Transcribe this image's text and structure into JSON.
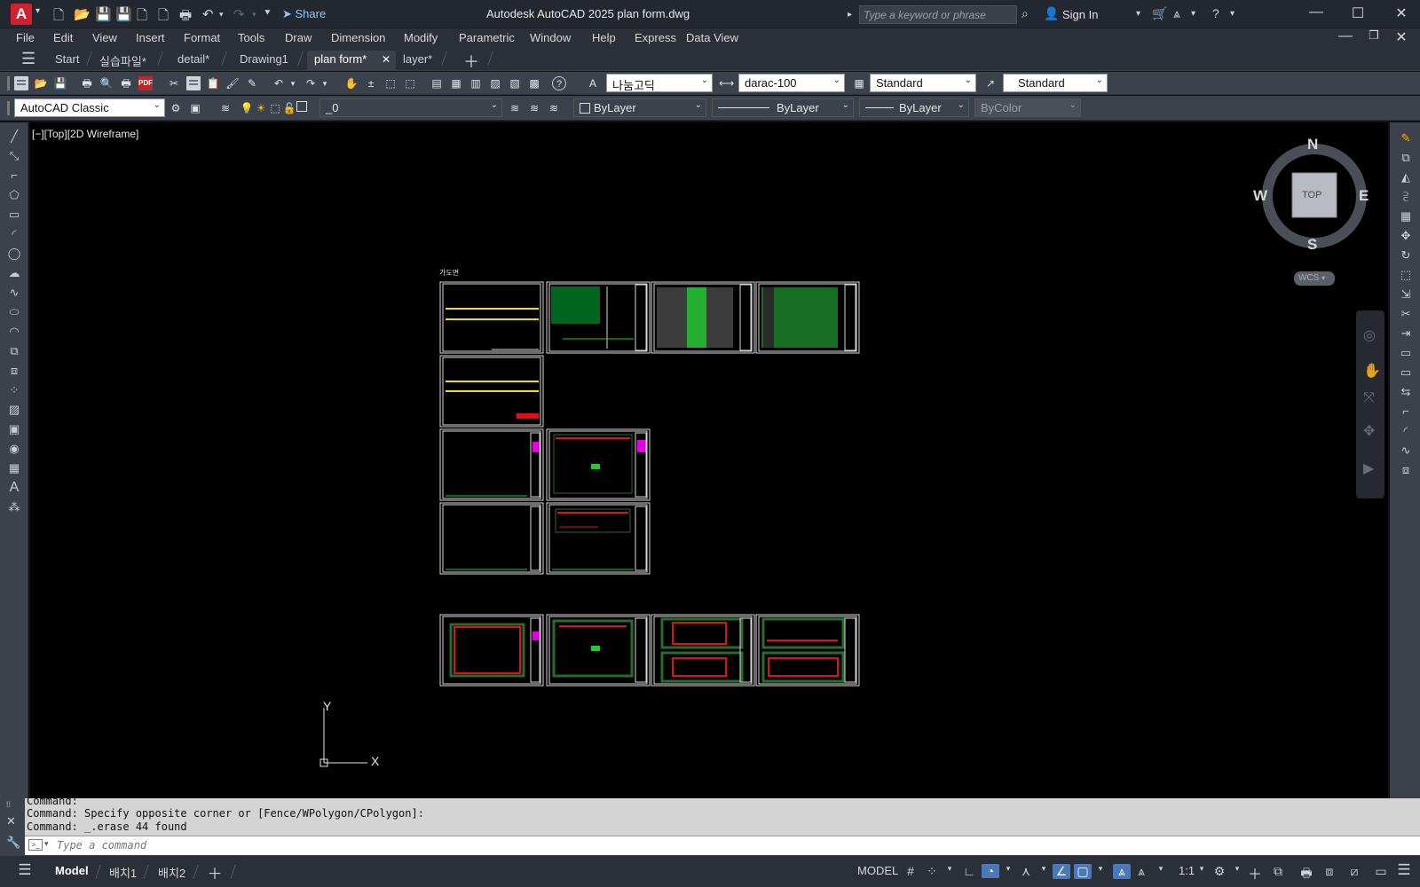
{
  "titlebar": {
    "app_letter": "A",
    "share_label": "Share",
    "title": "Autodesk AutoCAD 2025    plan form.dwg",
    "search_placeholder": "Type a keyword or phrase",
    "signin_label": "Sign In"
  },
  "menubar": {
    "items": [
      "File",
      "Edit",
      "View",
      "Insert",
      "Format",
      "Tools",
      "Draw",
      "Dimension",
      "Modify",
      "Parametric",
      "Window",
      "Help",
      "Express",
      "Data View"
    ]
  },
  "tabs": [
    {
      "label": "Start"
    },
    {
      "label": "실습파일*"
    },
    {
      "label": "detail*"
    },
    {
      "label": "Drawing1"
    },
    {
      "label": "plan form*",
      "active": true,
      "close": "✕"
    },
    {
      "label": "layer*"
    }
  ],
  "toolbar1": {
    "font": "나눔고딕",
    "dimstyle": "darac-100",
    "tablestyle": "Standard",
    "mleaderstyle": "Standard"
  },
  "toolbar2": {
    "workspace": "AutoCAD Classic",
    "layer": "_0",
    "color": "ByLayer",
    "linetype": "ByLayer",
    "lineweight": "ByLayer",
    "plotstyle": "ByColor"
  },
  "viewport": {
    "label": "[−][Top][2D Wireframe]",
    "sheet_group_label": "가도면"
  },
  "viewcube": {
    "north": "N",
    "south": "S",
    "east": "E",
    "west": "W",
    "face": "TOP",
    "wcs": "WCS"
  },
  "ucs": {
    "x": "X",
    "y": "Y"
  },
  "command": {
    "lines": [
      "Command:",
      "Command: Specify opposite corner or [Fence/WPolygon/CPolygon]:",
      "Command: _.erase 44 found"
    ],
    "placeholder": "Type a command"
  },
  "status": {
    "model_tab": "Model",
    "layout1": "배치1",
    "layout2": "배치2",
    "model_label": "MODEL",
    "scale": "1:1"
  },
  "colors": {
    "accent": "#4a78b8",
    "canvas": "#000000",
    "logo": "#d2202f"
  }
}
